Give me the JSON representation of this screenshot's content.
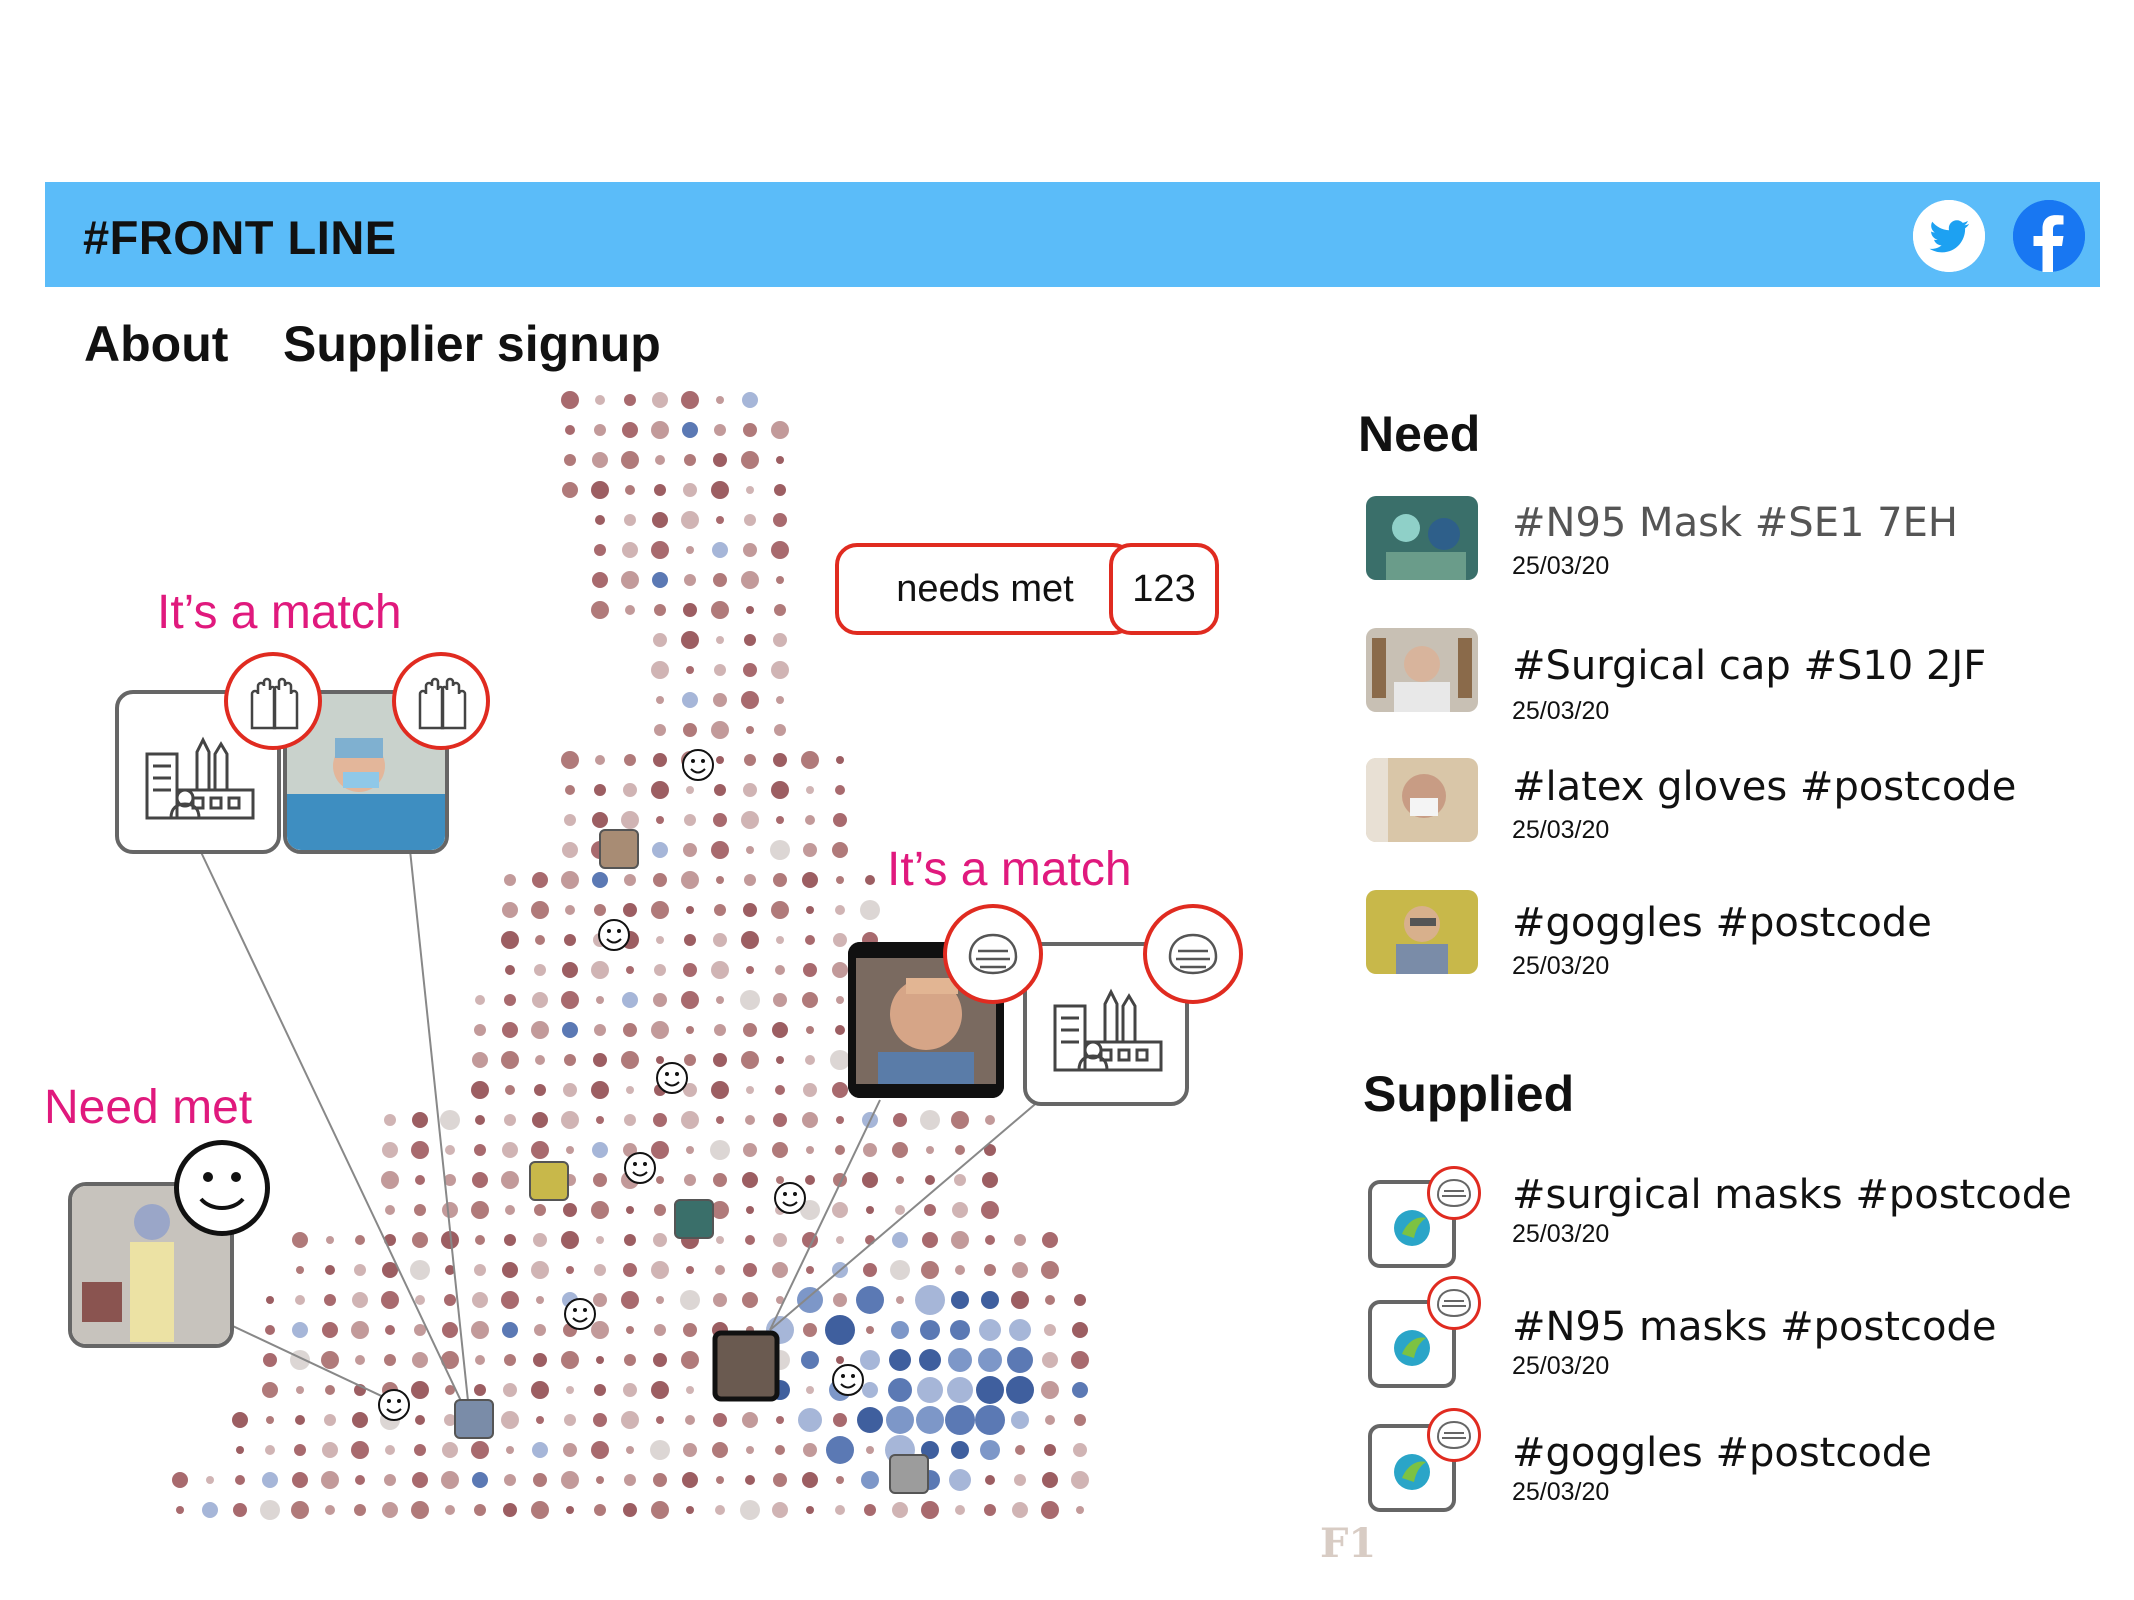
{
  "header": {
    "brand": "#FRONT LINE"
  },
  "nav": {
    "about": "About",
    "supplier_signup": "Supplier signup"
  },
  "map": {
    "match_label_1": "It’s a match",
    "match_label_2": "It’s a match",
    "need_met_label": "Need met",
    "needs_met_label": "needs met",
    "needs_met_count": "123"
  },
  "need": {
    "title": "Need",
    "items": [
      {
        "tag": "#N95 Mask #SE1 7EH",
        "date": "25/03/20"
      },
      {
        "tag": "#Surgical cap #S10 2JF",
        "date": "25/03/20"
      },
      {
        "tag": " #latex gloves #postcode",
        "date": "25/03/20"
      },
      {
        "tag": "#goggles #postcode",
        "date": "25/03/20"
      }
    ]
  },
  "supplied": {
    "title": "Supplied",
    "items": [
      {
        "tag": "#surgical masks #postcode",
        "date": "25/03/20"
      },
      {
        "tag": "#N95 masks #postcode",
        "date": "25/03/20"
      },
      {
        "tag": "#goggles #postcode",
        "date": "25/03/20"
      }
    ]
  },
  "footer_logo": "F1",
  "colors": {
    "banner": "#5bbcf9",
    "accent": "#e02b20",
    "headline": "#e0197d",
    "dot_red": "#b07a7a",
    "dot_blue": "#5b79b4"
  }
}
